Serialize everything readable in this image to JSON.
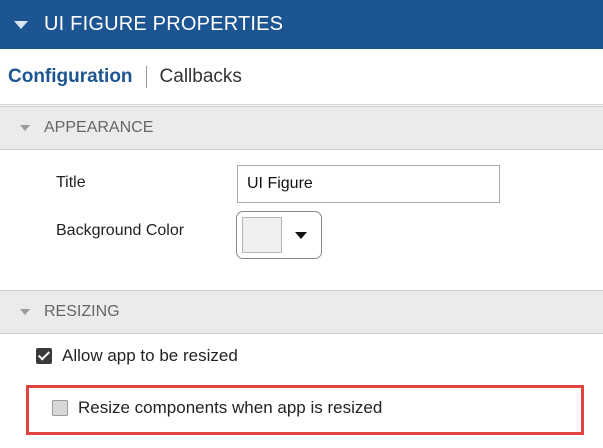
{
  "header": {
    "title": "UI FIGURE PROPERTIES",
    "collapse_icon": "triangle-down-icon"
  },
  "tabs": [
    {
      "label": "Configuration",
      "active": true
    },
    {
      "label": "Callbacks",
      "active": false
    }
  ],
  "appearance": {
    "section_label": "APPEARANCE",
    "title_label": "Title",
    "title_value": "UI Figure",
    "background_color_label": "Background Color",
    "background_color_swatch": "#f0f0f0"
  },
  "resizing": {
    "section_label": "RESIZING",
    "allow_resize_label": "Allow app to be resized",
    "allow_resize_checked": true,
    "resize_components_label": "Resize components when app is resized",
    "resize_components_checked": false
  },
  "colors": {
    "header_bg": "#1c5591",
    "accent": "#1c5591",
    "highlight": "#e0443f"
  }
}
